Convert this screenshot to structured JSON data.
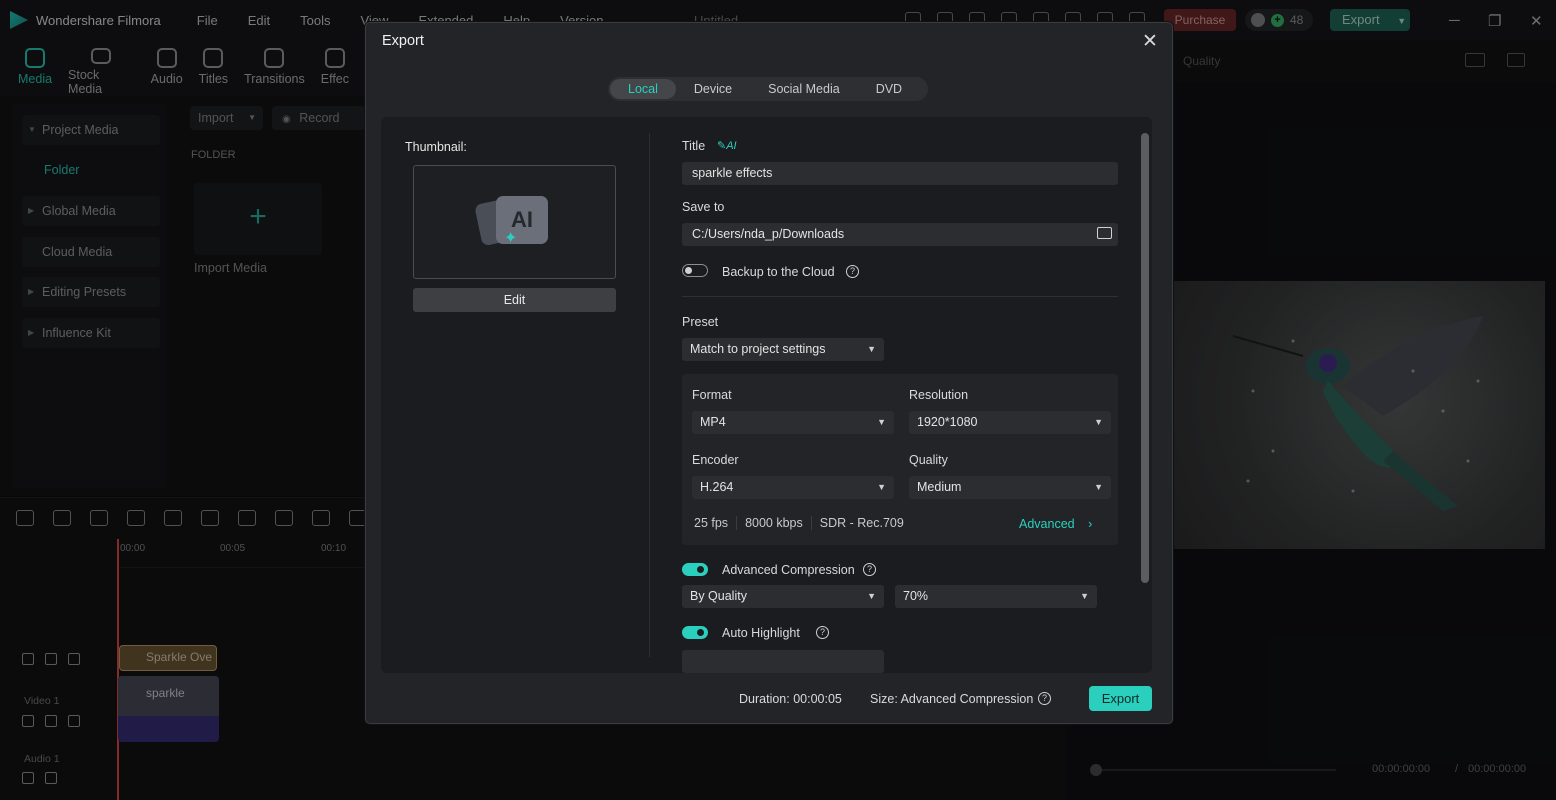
{
  "app": {
    "name": "Wondershare Filmora",
    "menus": [
      "File",
      "Edit",
      "Tools",
      "View",
      "Extended",
      "Help",
      "Version"
    ],
    "document_title": "Untitled",
    "purchase_label": "Purchase",
    "credits": "48",
    "export_label": "Export"
  },
  "left": {
    "tabs": [
      {
        "label": "Media",
        "icon": "media-icon"
      },
      {
        "label": "Stock Media",
        "icon": "stock-media-icon"
      },
      {
        "label": "Audio",
        "icon": "audio-icon"
      },
      {
        "label": "Titles",
        "icon": "titles-icon"
      },
      {
        "label": "Transitions",
        "icon": "transitions-icon"
      },
      {
        "label": "Effec",
        "icon": "effects-icon"
      }
    ],
    "sidebar": [
      {
        "label": "Project Media"
      },
      {
        "label": "Folder"
      },
      {
        "label": "Global Media"
      },
      {
        "label": "Cloud Media"
      },
      {
        "label": "Editing Presets"
      },
      {
        "label": "Influence Kit"
      }
    ],
    "import_label": "Import",
    "record_label": "Record",
    "folder_header": "FOLDER",
    "import_media_label": "Import Media"
  },
  "timeline": {
    "ruler": [
      "00:00",
      "00:05",
      "00:10"
    ],
    "tracks": [
      "Video 1",
      "Audio 1"
    ],
    "overlay_clip": "Sparkle Ove",
    "video_clip": "sparkle"
  },
  "preview": {
    "quality_label": "Quality",
    "time_current": "00:00:00:00",
    "time_separator": "/",
    "time_total": "00:00:00:00"
  },
  "dialog": {
    "title": "Export",
    "tabs": [
      "Local",
      "Device",
      "Social Media",
      "DVD"
    ],
    "active_tab": "Local",
    "thumbnail_label": "Thumbnail:",
    "thumbnail_badge": "AI",
    "edit_label": "Edit",
    "title_label": "Title",
    "title_ai_badge": "AI",
    "title_value": "sparkle effects",
    "save_to_label": "Save to",
    "save_to_value": "C:/Users/nda_p/Downloads",
    "backup_label": "Backup to the Cloud",
    "preset_label": "Preset",
    "preset_value": "Match to project settings",
    "format_label": "Format",
    "format_value": "MP4",
    "resolution_label": "Resolution",
    "resolution_value": "1920*1080",
    "encoder_label": "Encoder",
    "encoder_value": "H.264",
    "quality_label": "Quality",
    "quality_value": "Medium",
    "fps": "25 fps",
    "bitrate": "8000 kbps",
    "color_space": "SDR - Rec.709",
    "advanced_label": "Advanced",
    "adv_compression_label": "Advanced Compression",
    "compression_mode": "By Quality",
    "compression_percent": "70%",
    "auto_highlight_label": "Auto Highlight",
    "duration_text": "Duration: 00:00:05",
    "size_text": "Size:  Advanced Compression",
    "export_label": "Export",
    "accent_color": "#2ad0bd"
  }
}
